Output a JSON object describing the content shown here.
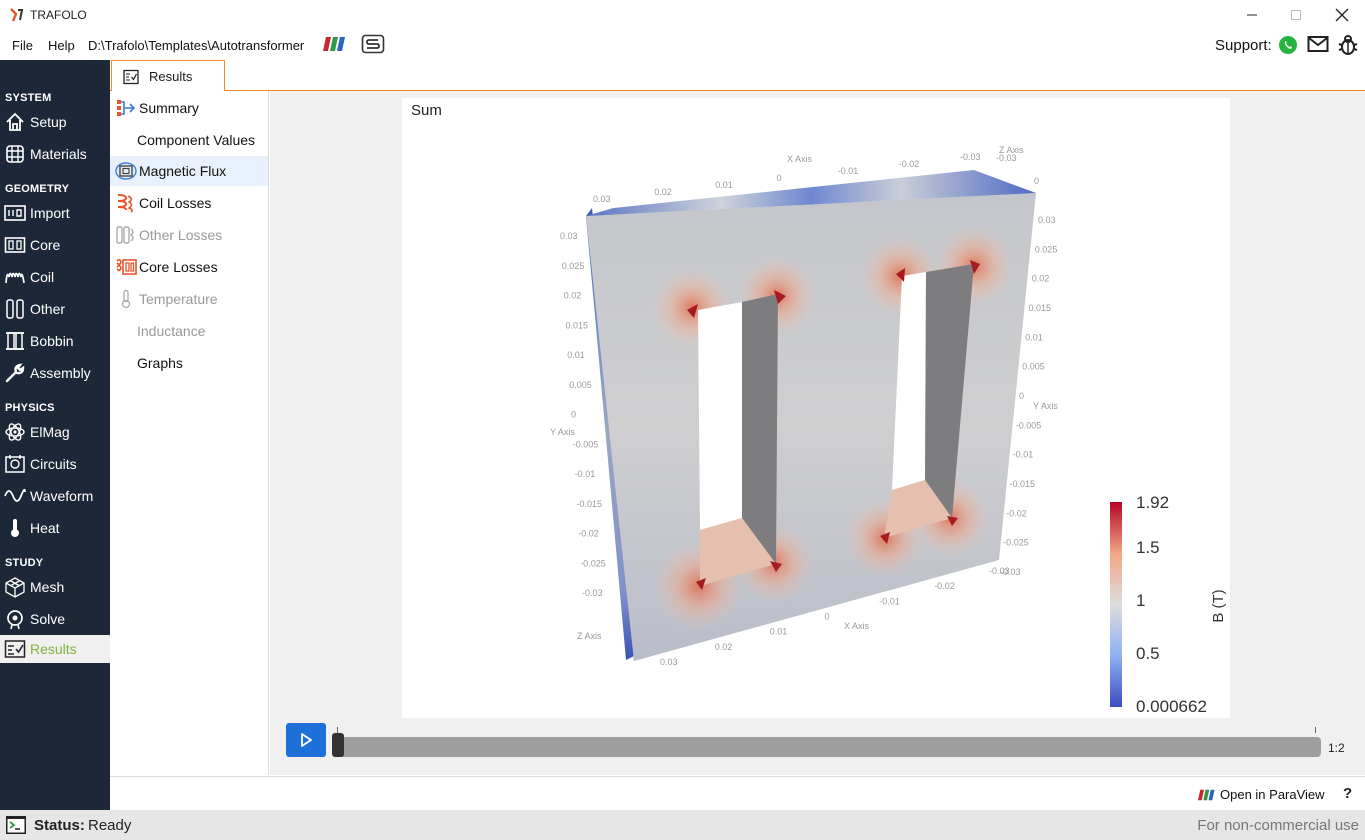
{
  "window": {
    "title": "TRAFOLO"
  },
  "menu": {
    "file": "File",
    "help": "Help",
    "path": "D:\\Trafolo\\Templates\\Autotransformer",
    "support_label": "Support:"
  },
  "sidebar": {
    "sections": [
      {
        "title": "SYSTEM",
        "items": [
          {
            "label": "Setup",
            "icon": "home-icon"
          },
          {
            "label": "Materials",
            "icon": "grid-icon"
          }
        ]
      },
      {
        "title": "GEOMETRY",
        "items": [
          {
            "label": "Import",
            "icon": "import-icon"
          },
          {
            "label": "Core",
            "icon": "core-icon"
          },
          {
            "label": "Coil",
            "icon": "coil-icon"
          },
          {
            "label": "Other",
            "icon": "other-icon"
          },
          {
            "label": "Bobbin",
            "icon": "bobbin-icon"
          },
          {
            "label": "Assembly",
            "icon": "wrench-icon"
          }
        ]
      },
      {
        "title": "PHYSICS",
        "items": [
          {
            "label": "ElMag",
            "icon": "atom-icon"
          },
          {
            "label": "Circuits",
            "icon": "circuit-icon"
          },
          {
            "label": "Waveform",
            "icon": "wave-icon"
          },
          {
            "label": "Heat",
            "icon": "thermometer-icon"
          }
        ]
      },
      {
        "title": "STUDY",
        "items": [
          {
            "label": "Mesh",
            "icon": "mesh-icon"
          },
          {
            "label": "Solve",
            "icon": "solve-icon"
          },
          {
            "label": "Results",
            "icon": "results-icon"
          }
        ]
      }
    ],
    "active": "Results",
    "active_color": "#7fb33b"
  },
  "tabs": [
    {
      "label": "Results"
    }
  ],
  "results_list": [
    {
      "label": "Summary",
      "icon": "summary-icon",
      "state": "normal"
    },
    {
      "label": "Component Values",
      "icon": "",
      "state": "normal"
    },
    {
      "label": "Magnetic Flux",
      "icon": "magnetic-flux-icon",
      "state": "selected"
    },
    {
      "label": "Coil Losses",
      "icon": "coil-losses-icon",
      "state": "normal"
    },
    {
      "label": "Other Losses",
      "icon": "other-losses-icon",
      "state": "disabled"
    },
    {
      "label": "Core Losses",
      "icon": "core-losses-icon",
      "state": "normal"
    },
    {
      "label": "Temperature",
      "icon": "thermometer-icon",
      "state": "disabled"
    },
    {
      "label": "Inductance",
      "icon": "",
      "state": "disabled"
    },
    {
      "label": "Graphs",
      "icon": "",
      "state": "normal"
    }
  ],
  "viewer": {
    "title": "Sum",
    "colorbar": {
      "title": "B (T)",
      "max": "1.92",
      "tick1": "1.5",
      "tick2": "1",
      "tick3": "0.5",
      "min": "0.000662"
    },
    "axes": {
      "x_title": "X Axis",
      "y_title": "Y Axis",
      "z_title": "Z Axis",
      "top_x_ticks": [
        "0.03",
        "0.02",
        "0.01",
        "0",
        "-0.01",
        "-0.02",
        "-0.03"
      ],
      "left_y_ticks": [
        "0.03",
        "0.025",
        "0.02",
        "0.015",
        "0.01",
        "0.005",
        "0",
        "-0.005",
        "-0.01",
        "-0.015",
        "-0.02",
        "-0.025",
        "-0.03"
      ],
      "right_y_ticks": [
        "0.03",
        "0.025",
        "0.02",
        "0.015",
        "0.01",
        "0.005",
        "0",
        "-0.005",
        "-0.01",
        "-0.015",
        "-0.02",
        "-0.025",
        "-0.03"
      ],
      "bottom_x_ticks": [
        "0.03",
        "0.02",
        "0.01",
        "0",
        "-0.01",
        "-0.02",
        "-0.03"
      ],
      "top_z_ticks": [
        "-0.03",
        "0"
      ],
      "right_z_ticks": [
        "-0.03",
        "0"
      ],
      "left_z_ticks": [
        "-0.03",
        "0"
      ]
    }
  },
  "animation": {
    "frame": "1:2",
    "progress": 0.0
  },
  "paraview": {
    "label": "Open in ParaView",
    "help": "?"
  },
  "status": {
    "label": "Status:",
    "value": "Ready",
    "license": "For non-commercial use"
  },
  "colors": {
    "accent": "#f08a24",
    "sidebar_bg": "#1c2837",
    "play_button": "#1f6fd8",
    "colormap_high": "#b40426",
    "colormap_mid": "#dddddd",
    "colormap_low": "#3b4cc0"
  }
}
